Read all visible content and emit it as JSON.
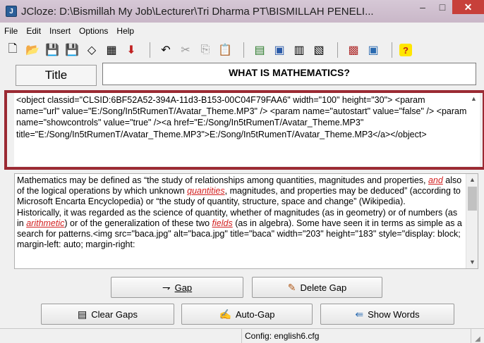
{
  "window": {
    "app_icon": "jcloze-app-icon",
    "title": "JCloze: D:\\Bismillah My Job\\Lecturer\\Tri Dharma PT\\BISMILLAH PENELI...",
    "minimize": "–",
    "maximize": "□",
    "close": "✕"
  },
  "menu": [
    "File",
    "Edit",
    "Insert",
    "Options",
    "Help"
  ],
  "toolbar": {
    "icons": [
      {
        "name": "new-file-icon",
        "glyph": "🗋"
      },
      {
        "name": "open-folder-icon",
        "glyph": "📂"
      },
      {
        "name": "save-icon",
        "glyph": "💾"
      },
      {
        "name": "save-as-icon",
        "glyph": "💾"
      },
      {
        "name": "eraser-icon",
        "glyph": "◇"
      },
      {
        "name": "web-page-icon",
        "glyph": "▦"
      },
      {
        "name": "arrow-down-icon",
        "glyph": "⬇"
      },
      {
        "name": "undo-icon",
        "glyph": "↶"
      },
      {
        "name": "cut-icon",
        "glyph": "✂"
      },
      {
        "name": "copy-icon",
        "glyph": "⎘"
      },
      {
        "name": "paste-icon",
        "glyph": "📋"
      },
      {
        "name": "gap-tool-icon",
        "glyph": "▤"
      },
      {
        "name": "image-icon",
        "glyph": "▣"
      },
      {
        "name": "grid-tool-icon",
        "glyph": "▥"
      },
      {
        "name": "config-tool-icon",
        "glyph": "▧"
      },
      {
        "name": "export-icon",
        "glyph": "▩"
      },
      {
        "name": "preview-icon",
        "glyph": "▣"
      },
      {
        "name": "help-icon",
        "glyph": "?"
      }
    ]
  },
  "title_label": "Title",
  "title_value": "WHAT IS MATHEMATICS?",
  "html_code": "<object classid=\"CLSID:6BF52A52-394A-11d3-B153-00C04F79FAA6\" width=\"100\" height=\"30\"> <param name=\"url\" value=\"E:/Song/In5tRumenT/Avatar_Theme.MP3\" /> <param name=\"autostart\" value=\"false\" /> <param name=\"showcontrols\" value=\"true\" /><a href=\"E:/Song/In5tRumenT/Avatar_Theme.MP3\" title=\"E:/Song/In5tRumenT/Avatar_Theme.MP3\">E:/Song/In5tRumenT/Avatar_Theme.MP3</a></object>",
  "text": {
    "p1_a": "Mathematics may be defined as “the study of relationships among quantities, magnitudes and properties, ",
    "gap_and": "and",
    "p1_b": " also of the logical operations by which unknown ",
    "gap_quantities": "quantities",
    "p1_c": ", magnitudes, and properties may be deduced” (according to Microsoft Encarta Encyclopedia) or “the study of quantity, structure, space and change” (Wikipedia).",
    "p2_a": "Historically, it was regarded as the science of quantity, whether of magnitudes (as in geometry) or of numbers (as in ",
    "gap_arithmetic": "arithmetic",
    "p2_b": ") or of the generalization of these two ",
    "gap_fields": "fields",
    "p2_c": " (as in algebra). Some have seen it in terms as simple as a search for patterns.<img src=\"baca.jpg\" alt=\"baca.jpg\" title=\"baca\" width=\"203\" height=\"183\" style=\"display: block; margin-left: auto; margin-right:"
  },
  "buttons": {
    "gap": {
      "label": "Gap",
      "icon": "gap-icon",
      "glyph": "⇁"
    },
    "delete_gap": {
      "label": "Delete Gap",
      "icon": "delete-gap-icon",
      "glyph": "✎"
    },
    "clear_gaps": {
      "label": "Clear Gaps",
      "icon": "clear-gaps-icon",
      "glyph": "▤"
    },
    "auto_gap": {
      "label": "Auto-Gap",
      "icon": "auto-gap-icon",
      "glyph": "✍"
    },
    "show_words": {
      "label": "Show Words",
      "icon": "show-words-icon",
      "glyph": "⇚"
    }
  },
  "status": {
    "config": "Config: english6.cfg"
  },
  "colors": {
    "gap": "#d21f1f",
    "highlight_border": "#9b2a33",
    "titlebar": "#d0bfd0",
    "close_button": "#c7403a"
  }
}
